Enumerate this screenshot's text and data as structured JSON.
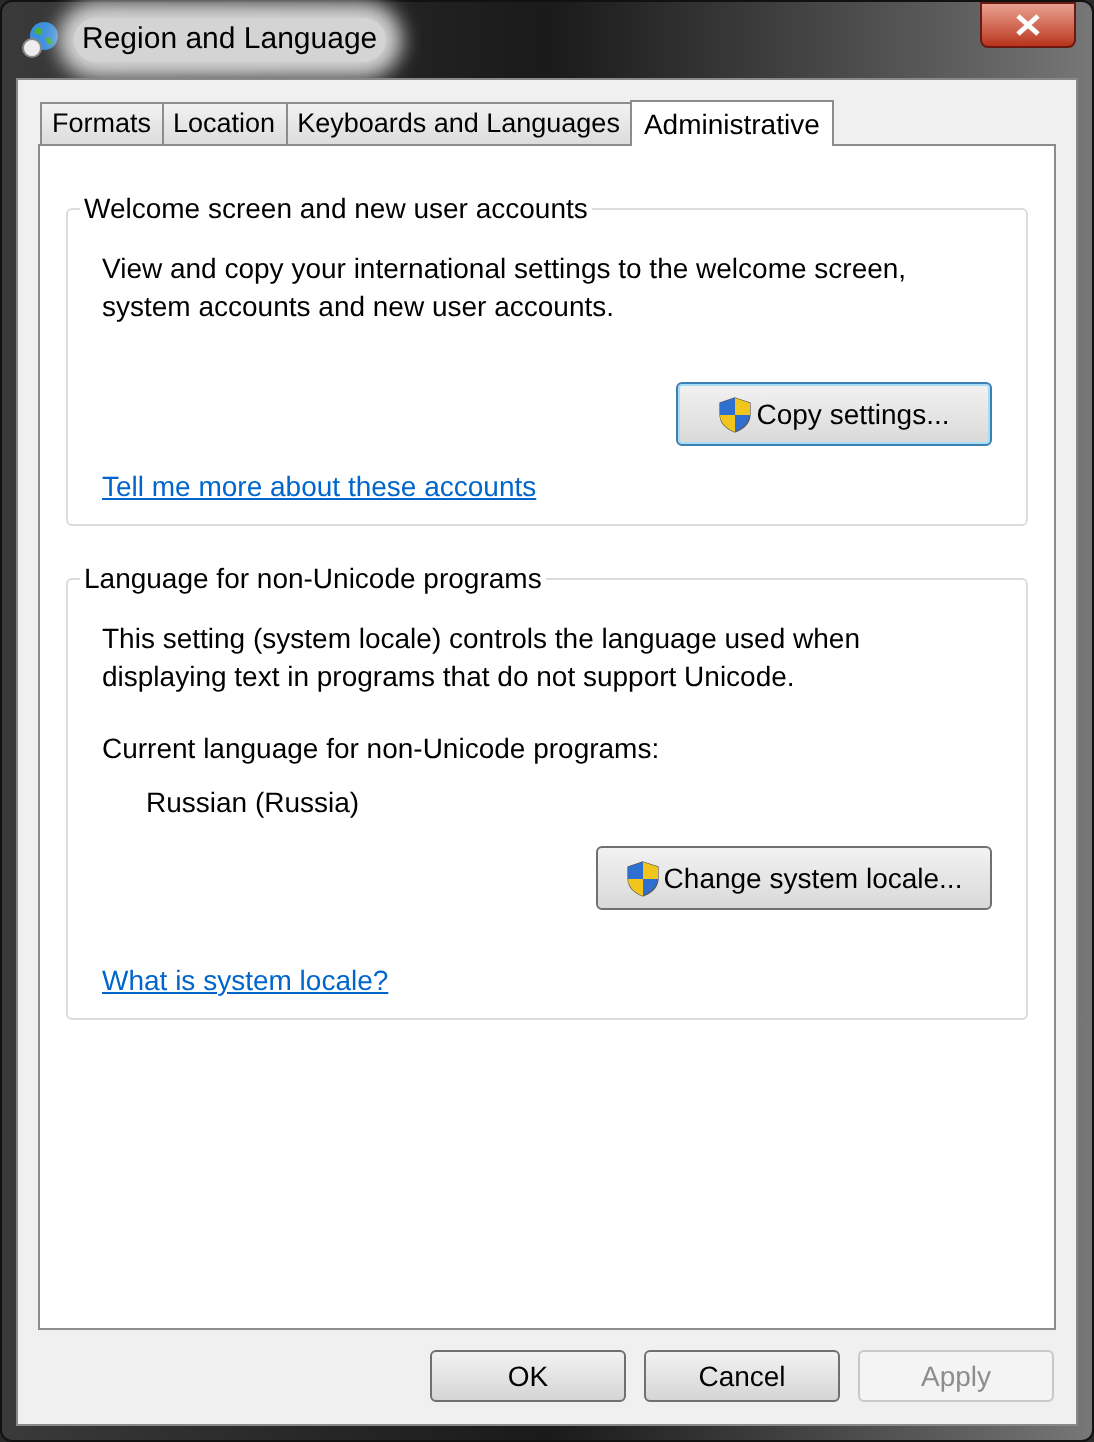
{
  "window": {
    "title": "Region and Language"
  },
  "tabs": [
    {
      "label": "Formats",
      "selected": false
    },
    {
      "label": "Location",
      "selected": false
    },
    {
      "label": "Keyboards and Languages",
      "selected": false
    },
    {
      "label": "Administrative",
      "selected": true
    }
  ],
  "groups": [
    {
      "title": "Welcome screen and new user accounts",
      "description": "View and copy your international settings to the welcome screen, system accounts and new user accounts.",
      "button": "Copy settings...",
      "link": "Tell me more about these accounts"
    },
    {
      "title": "Language for non-Unicode programs",
      "description": "This setting (system locale) controls the language used when displaying text in programs that do not support Unicode.",
      "current_label": "Current language for non-Unicode programs:",
      "current_value": "Russian (Russia)",
      "button": "Change system locale...",
      "link": "What is system locale?"
    }
  ],
  "buttons": [
    {
      "label": "OK",
      "disabled": false
    },
    {
      "label": "Cancel",
      "disabled": false
    },
    {
      "label": "Apply",
      "disabled": true
    }
  ]
}
